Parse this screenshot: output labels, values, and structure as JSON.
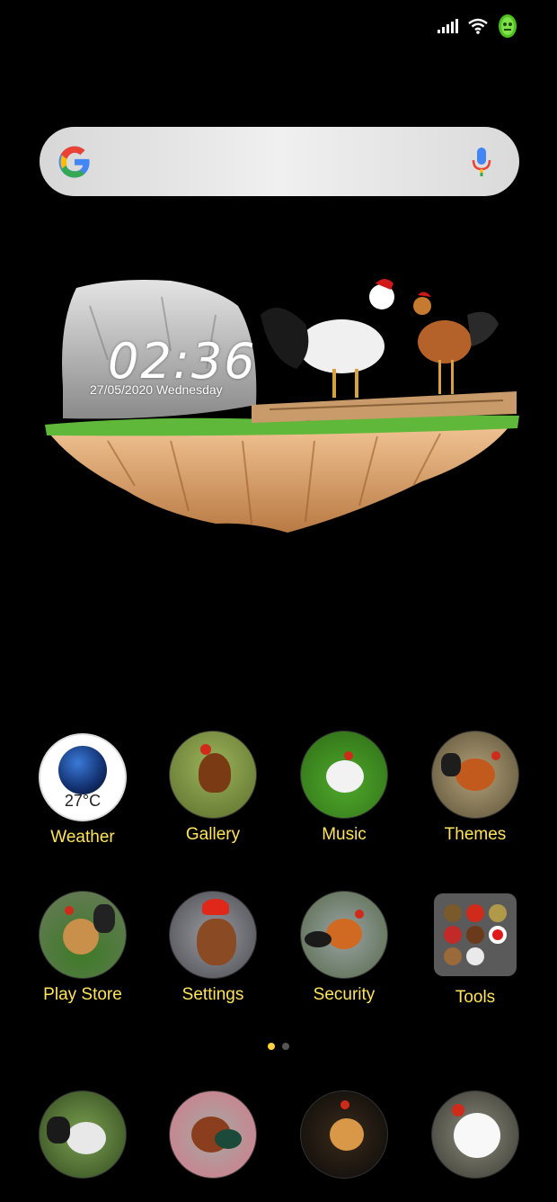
{
  "colors": {
    "label": "#ffe45c",
    "background": "#000000",
    "dot_active": "#ffd23f",
    "dot_inactive": "#555555"
  },
  "status_bar": {
    "icons": [
      "signal-icon",
      "wifi-icon",
      "battery-icon"
    ]
  },
  "search": {
    "icons": [
      "google-logo-icon",
      "mic-icon"
    ]
  },
  "clock": {
    "time": "02:36",
    "date": "27/05/2020 Wednesday"
  },
  "weather": {
    "temperature": "27°C"
  },
  "apps_row1": [
    {
      "label": "Weather"
    },
    {
      "label": "Gallery"
    },
    {
      "label": "Music"
    },
    {
      "label": "Themes"
    }
  ],
  "apps_row2": [
    {
      "label": "Play Store"
    },
    {
      "label": "Settings"
    },
    {
      "label": "Security"
    },
    {
      "label": "Tools"
    }
  ],
  "page_indicator": {
    "pages": 2,
    "current": 1
  }
}
